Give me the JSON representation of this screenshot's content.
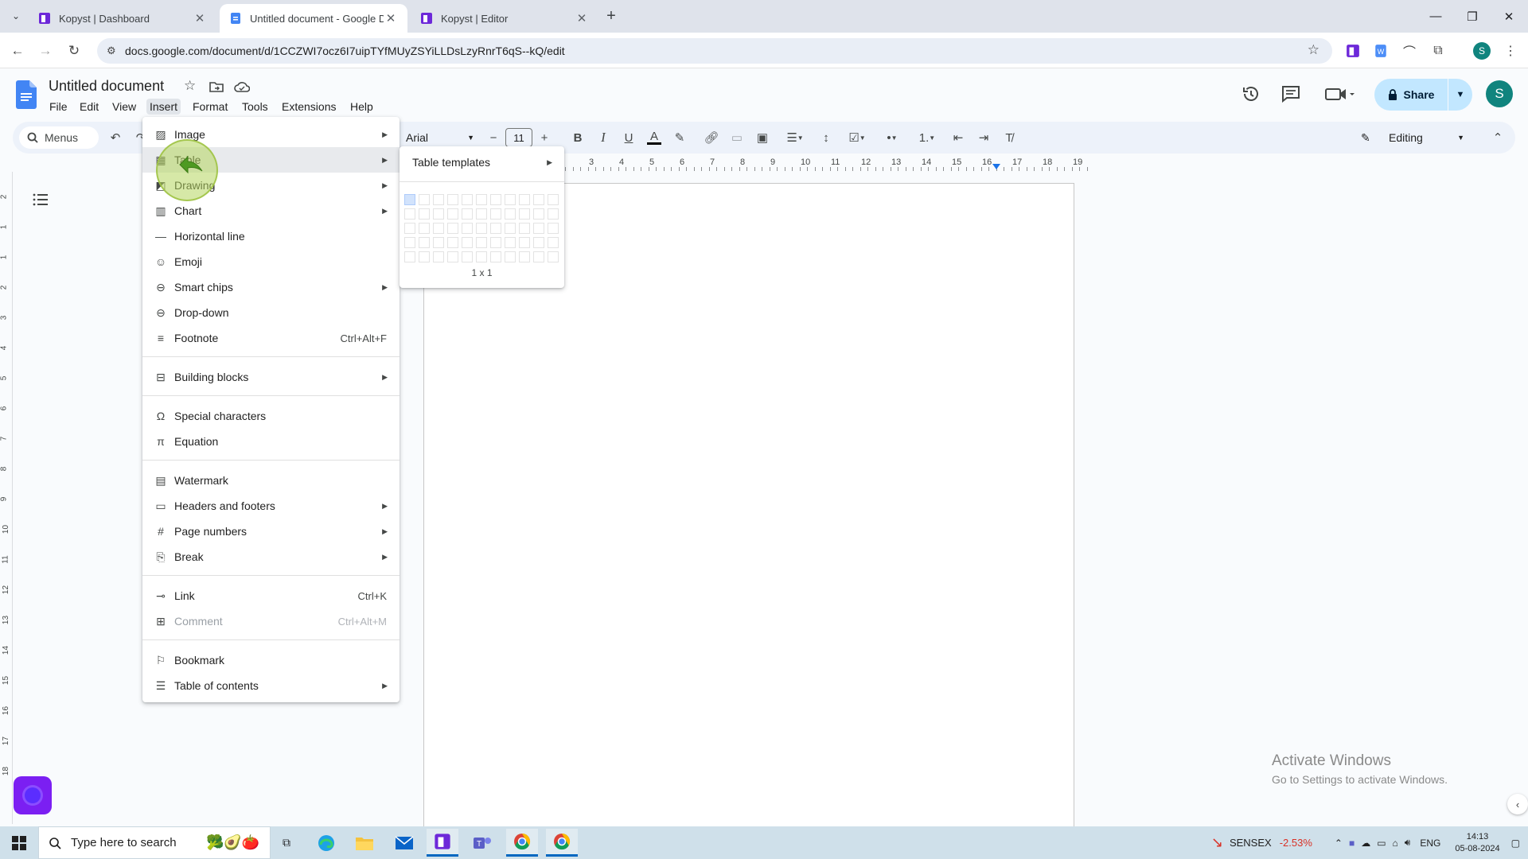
{
  "browser": {
    "tabs": [
      {
        "label": "Kopyst | Dashboard",
        "active": false
      },
      {
        "label": "Untitled document - Google Docs",
        "active": true
      },
      {
        "label": "Kopyst | Editor",
        "active": false
      }
    ],
    "url": "docs.google.com/document/d/1CCZWI7ocz6I7uipTYfMUyZSYiLLDsLzyRnrT6qS--kQ/edit",
    "profile_initial": "S"
  },
  "docs": {
    "title": "Untitled document",
    "menubar": [
      "File",
      "Edit",
      "View",
      "Insert",
      "Format",
      "Tools",
      "Extensions",
      "Help"
    ],
    "share_label": "Share",
    "avatar_initial": "S",
    "toolbar": {
      "menus_label": "Menus",
      "font": "Arial",
      "font_size": "11",
      "mode": "Editing"
    },
    "ruler_numbers": [
      "3",
      "4",
      "5",
      "6",
      "7",
      "8",
      "9",
      "10",
      "11",
      "12",
      "13",
      "14",
      "15",
      "16",
      "17",
      "18",
      "19"
    ],
    "vruler_numbers": [
      "2",
      "1",
      "1",
      "2",
      "3",
      "4",
      "5",
      "6",
      "7",
      "8",
      "9",
      "10",
      "11",
      "12",
      "13",
      "14",
      "15",
      "16",
      "17",
      "18"
    ]
  },
  "insert_menu": {
    "items": [
      {
        "label": "Image",
        "icon": "image-icon",
        "submenu": true
      },
      {
        "label": "Table",
        "icon": "table-icon",
        "submenu": true,
        "hover": true
      },
      {
        "label": "Drawing",
        "icon": "drawing-icon",
        "submenu": true
      },
      {
        "label": "Chart",
        "icon": "chart-icon",
        "submenu": true
      },
      {
        "label": "Horizontal line",
        "icon": "horizontal-line-icon"
      },
      {
        "label": "Emoji",
        "icon": "emoji-icon"
      },
      {
        "label": "Smart chips",
        "icon": "smart-chips-icon",
        "submenu": true
      },
      {
        "label": "Drop-down",
        "icon": "dropdown-icon"
      },
      {
        "label": "Footnote",
        "icon": "footnote-icon",
        "shortcut": "Ctrl+Alt+F"
      },
      {
        "separator": true
      },
      {
        "label": "Building blocks",
        "icon": "building-blocks-icon",
        "submenu": true
      },
      {
        "separator": true
      },
      {
        "label": "Special characters",
        "icon": "omega-icon"
      },
      {
        "label": "Equation",
        "icon": "pi-icon"
      },
      {
        "separator": true
      },
      {
        "label": "Watermark",
        "icon": "watermark-icon"
      },
      {
        "label": "Headers and footers",
        "icon": "headers-footers-icon",
        "submenu": true
      },
      {
        "label": "Page numbers",
        "icon": "hash-icon",
        "submenu": true
      },
      {
        "label": "Break",
        "icon": "break-icon",
        "submenu": true
      },
      {
        "separator": true
      },
      {
        "label": "Link",
        "icon": "link-icon",
        "shortcut": "Ctrl+K"
      },
      {
        "label": "Comment",
        "icon": "comment-icon",
        "shortcut": "Ctrl+Alt+M",
        "disabled": true
      },
      {
        "separator": true
      },
      {
        "label": "Bookmark",
        "icon": "bookmark-icon"
      },
      {
        "label": "Table of contents",
        "icon": "toc-icon",
        "submenu": true
      }
    ]
  },
  "table_submenu": {
    "templates_label": "Table templates",
    "grid_cols": 11,
    "grid_rows": 5,
    "selection_label": "1 x 1"
  },
  "watermark_text": {
    "line1": "Activate Windows",
    "line2": "Go to Settings to activate Windows."
  },
  "taskbar": {
    "search_placeholder": "Type here to search",
    "sensex_label": "SENSEX",
    "sensex_change": "-2.53%",
    "lang": "ENG",
    "time": "14:13",
    "date": "05-08-2024"
  },
  "colors": {
    "accent": "#0b57d0",
    "share_bg": "#c2e7ff",
    "sensex_negative": "#d93025"
  }
}
